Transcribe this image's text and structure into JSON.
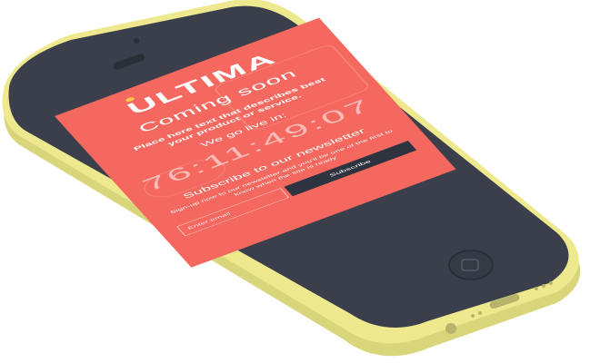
{
  "phone": {
    "body_color": "#eee88e",
    "bezel_color": "#3a3f4b",
    "screen_color": "#f4685f",
    "button_color": "#2d3440",
    "logo_dot_color": "#f7c84a"
  },
  "screen": {
    "logo": "ULTIMA",
    "title": "Coming soon",
    "tagline": "Place here text that describes best your product or service.",
    "golive_label": "We go live in:",
    "countdown": "76:11:49:07",
    "newsletter_title": "Subscribe to our newsletter",
    "newsletter_text": "Sign-up now to our newsletter and you'll be one of the first to know when the site is ready",
    "email_placeholder": "Enter email",
    "subscribe_label": "Subscribe"
  }
}
